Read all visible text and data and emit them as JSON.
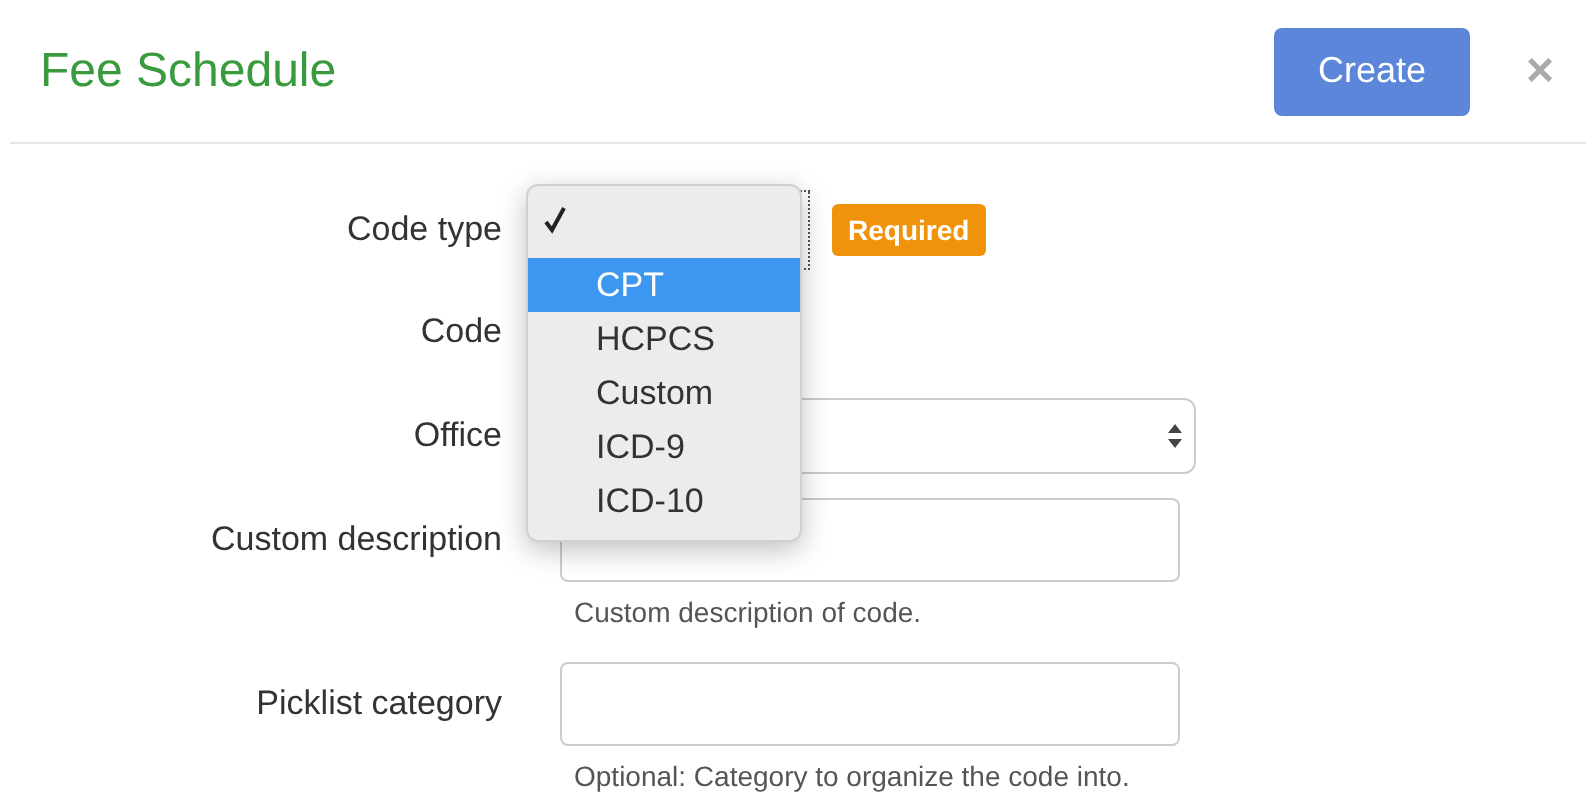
{
  "header": {
    "title": "Fee Schedule",
    "create_button": "Create",
    "close": "×"
  },
  "fields": [
    {
      "label": "Code type",
      "kind": "select",
      "badge": "Required"
    },
    {
      "label": "Code",
      "kind": "empty"
    },
    {
      "label": "Office",
      "kind": "select"
    },
    {
      "label": "Custom description",
      "kind": "text",
      "help": "Custom description of code."
    },
    {
      "label": "Picklist category",
      "kind": "text",
      "help": "Optional: Category to organize the code into."
    }
  ],
  "dropdown": {
    "options": [
      {
        "checked": true,
        "selected": false
      },
      {
        "label": "CPT",
        "checked": false,
        "selected": true
      },
      {
        "label": "HCPCS",
        "checked": false,
        "selected": false
      },
      {
        "label": "Custom",
        "checked": false,
        "selected": false
      },
      {
        "label": "ICD-9",
        "checked": false,
        "selected": false
      },
      {
        "label": "ICD-10",
        "checked": false,
        "selected": false
      }
    ]
  }
}
